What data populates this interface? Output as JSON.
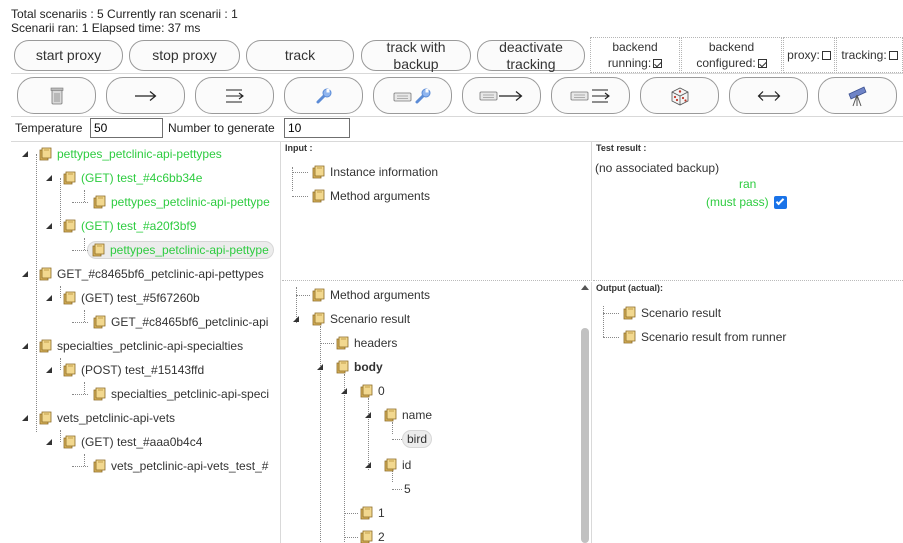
{
  "status": {
    "line1": "Total scenariis : 5 Currently ran scenarii : 1",
    "line2": "Scenarii ran: 1   Elapsed time: 37 ms"
  },
  "actions": {
    "start_proxy": "start proxy",
    "stop_proxy": "stop proxy",
    "track": "track",
    "track_backup_1": "track with",
    "track_backup_2": "backup",
    "deactivate_1": "deactivate",
    "deactivate_2": "tracking"
  },
  "state": {
    "backend_running_1": "backend",
    "backend_running_2": "running:",
    "backend_configured_1": "backend",
    "backend_configured_2": "configured:",
    "proxy": "proxy:",
    "tracking": "tracking:"
  },
  "inputs": {
    "temperature_label": "Temperature",
    "temperature_value": "50",
    "number_label": "Number to generate",
    "number_value": "10"
  },
  "tree": {
    "n1": "pettypes_petclinic-api-pettypes",
    "n2": "(GET) test_#4c6bb34e",
    "n3": "pettypes_petclinic-api-pettype",
    "n4": "(GET) test_#a20f3bf9",
    "n5": "pettypes_petclinic-api-pettype",
    "n6": "GET_#c8465bf6_petclinic-api-pettypes",
    "n7": "(GET) test_#5f67260b",
    "n8": "GET_#c8465bf6_petclinic-api",
    "n9": "specialties_petclinic-api-specialties",
    "n10": "(POST) test_#15143ffd",
    "n11": "specialties_petclinic-api-speci",
    "n12": "vets_petclinic-api-vets",
    "n13": "(GET) test_#aaa0b4c4",
    "n14": "vets_petclinic-api-vets_test_#"
  },
  "input_panel": {
    "title": "Input :",
    "instance": "Instance information",
    "method_args": "Method arguments"
  },
  "result_panel": {
    "title": "Test result :",
    "no_backup": "(no associated backup)",
    "ran": "ran",
    "must_pass": "(must pass)"
  },
  "scenario_panel": {
    "method_args": "Method arguments",
    "scenario_result": "Scenario result",
    "headers": "headers",
    "body": "body",
    "idx0": "0",
    "name": "name",
    "name_val": "bird",
    "id": "id",
    "id_val": "5",
    "idx1": "1",
    "idx2": "2"
  },
  "output_panel": {
    "title": "Output (actual):",
    "scenario_result": "Scenario result",
    "from_runner": "Scenario result from runner"
  },
  "colors": {
    "green": "#2ecc40",
    "folder": "#d9b45c",
    "separator": "#d9d9d9"
  }
}
